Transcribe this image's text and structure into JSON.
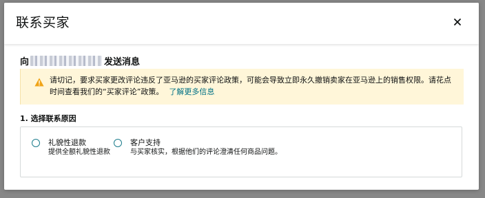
{
  "dialog": {
    "title": "联系买家",
    "close_icon": "close-icon"
  },
  "recipient": {
    "prefix": "向",
    "suffix": "发送消息"
  },
  "alert": {
    "icon": "warning-icon",
    "message": "请切记，要求买家更改评论违反了亚马逊的买家评论政策，可能会导致立即永久撤销卖家在亚马逊上的销售权限。请花点时间查看我们的“买家评论”政策。",
    "link_label": "了解更多信息",
    "accent": "#f0a417"
  },
  "reason": {
    "section_label": "1. 选择联系原因",
    "options": [
      {
        "title": "礼貌性退款",
        "description": "提供全额礼貌性退款"
      },
      {
        "title": "客户支持",
        "description": "与买家核实，根据他们的评论澄清任何商品问题。"
      }
    ],
    "radio_color": "#1c7c8c"
  },
  "colors": {
    "alert_background": "#fff6d9",
    "link": "#007185"
  }
}
